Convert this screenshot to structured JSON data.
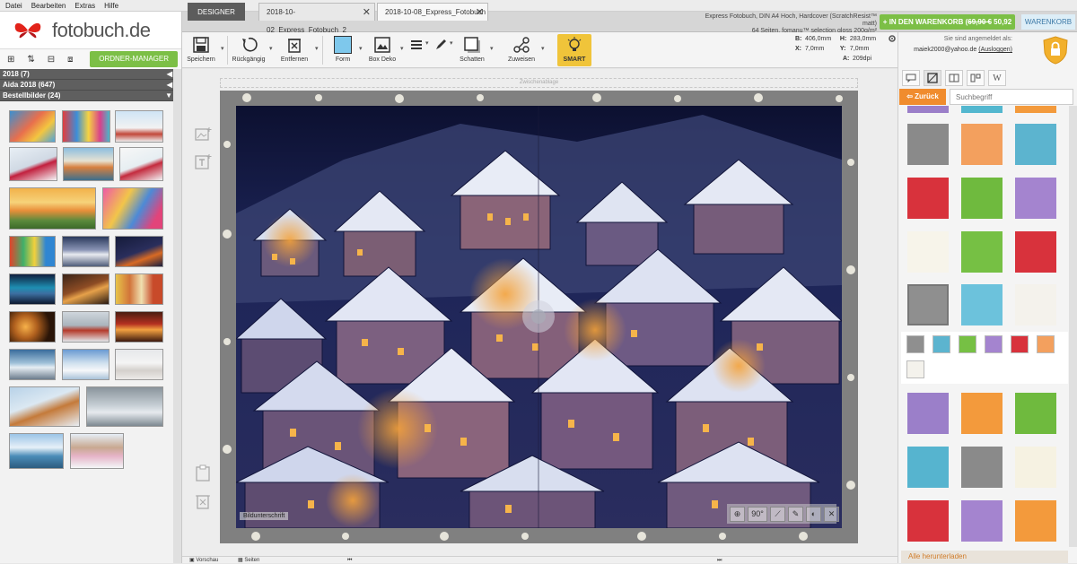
{
  "menubar": [
    "Datei",
    "Bearbeiten",
    "Extras",
    "Hilfe"
  ],
  "brand": {
    "name": "fotobuch.de"
  },
  "left": {
    "tools": [
      "⊞",
      "⇅",
      "⊟",
      "⧈"
    ],
    "organizer_button": "ORDNER-MANAGER",
    "groups": [
      {
        "label": "2018 (7)",
        "arrow": "◀"
      },
      {
        "label": "Aida 2018 (647)",
        "arrow": "◀"
      },
      {
        "label": "Bestellbilder (24)",
        "arrow": "▼"
      }
    ]
  },
  "tabs": [
    {
      "label": "DESIGNER"
    },
    {
      "label": "2018-10-02_Express_Fotobuch_2",
      "close": "✕"
    },
    {
      "label": "2018-10-08_Express_Fotobuch",
      "close": "✕"
    }
  ],
  "product": {
    "line1": "Express Fotobuch, DIN A4 Hoch, Hardcover (ScratchResist™ matt)",
    "line2": "64 Seiten, fomanu™ selection gloss 200g/m²"
  },
  "cart": {
    "prefix": "+ IN DEN WARENKORB (",
    "old_price": "69,90 €",
    "new_price": " 50,92 €)"
  },
  "warenkorb": "WARENKORB",
  "toolbar": {
    "save": "Speichern",
    "undo": "Rückgängig",
    "remove": "Entfernen",
    "shape": "Form",
    "box_deco": "Box Deko",
    "shadow": "Schatten",
    "assign": "Zuweisen",
    "smart": "SMART"
  },
  "dims": {
    "b": "406,0mm",
    "h": "283,0mm",
    "x": "7,0mm",
    "y": "7,0mm",
    "a": "209dpi"
  },
  "login": {
    "line1": "Sie sind angemeldet als:",
    "email": "maiek2000@yahoo.de",
    "logout": "(Ausloggen)"
  },
  "right": {
    "back": "⇦ Zurück",
    "search_placeholder": "Suchbegriff",
    "download": "Alle herunterladen"
  },
  "canvas": {
    "zwischen": "Zwischenablage",
    "caption": "Bildunterschrift",
    "rotate": "90°"
  },
  "bottom": {
    "left1": "Vorschau",
    "left2": "Seiten"
  },
  "colors": {
    "green": "#7cbf46",
    "orange": "#f08c2e",
    "dark": "#5c5c5c",
    "smart": "#f0c43a"
  }
}
